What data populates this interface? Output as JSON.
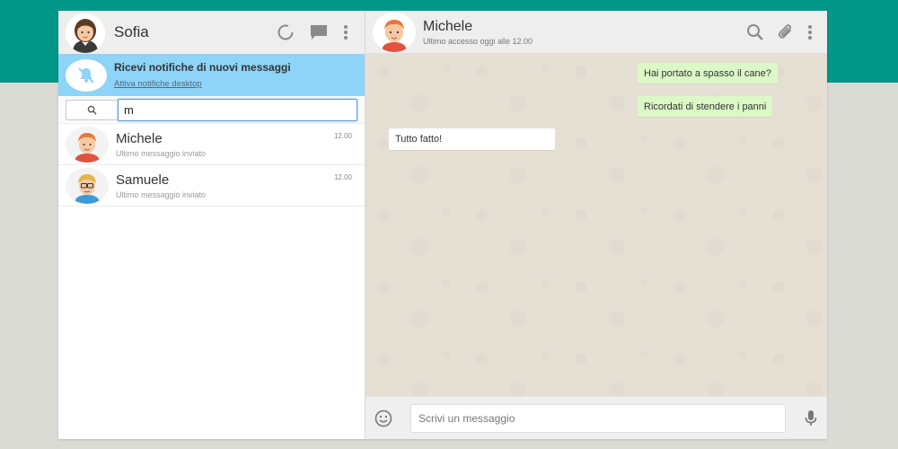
{
  "colors": {
    "brand": "#009688",
    "notification_bg": "#8ed3f8",
    "outgoing_bubble": "#dcf8c6",
    "incoming_bubble": "#ffffff"
  },
  "profile": {
    "name": "Sofia",
    "avatar": "woman-avatar"
  },
  "header_icons": [
    "status-icon",
    "chat-icon",
    "menu-icon"
  ],
  "notification": {
    "title": "Ricevi notifiche di nuovi messaggi",
    "link": "Attiva notifiche desktop",
    "icon": "bell-off-icon"
  },
  "search": {
    "value": "m",
    "icon": "search-icon"
  },
  "contacts": [
    {
      "name": "Michele",
      "last_message": "Ultimo messaggio inviato",
      "time": "12.00",
      "avatar": "redhead-man-avatar"
    },
    {
      "name": "Samuele",
      "last_message": "Ultimo messaggio inviato",
      "time": "12.00",
      "avatar": "blond-glasses-man-avatar"
    }
  ],
  "chat": {
    "name": "Michele",
    "status": "Ultimo accesso oggi alle 12.00",
    "icons": [
      "search-icon",
      "attach-icon",
      "menu-icon"
    ],
    "messages": [
      {
        "direction": "out",
        "text": "Hai portato a spasso il cane?"
      },
      {
        "direction": "out",
        "text": "Ricordati di stendere i panni"
      },
      {
        "direction": "in",
        "text": "Tutto fatto!"
      }
    ]
  },
  "composer": {
    "placeholder": "Scrivi un messaggio",
    "emoji_icon": "emoji-icon",
    "mic_icon": "microphone-icon"
  }
}
